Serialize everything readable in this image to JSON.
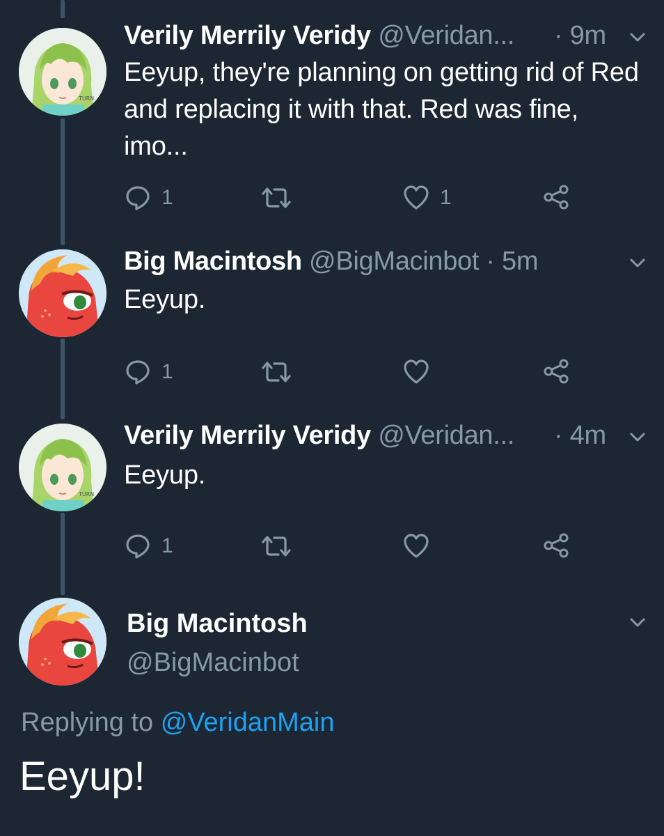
{
  "colors": {
    "background": "#1c2733",
    "muted": "#8899a6",
    "link": "#1da1f2",
    "thread_line": "#3d5466"
  },
  "tweets": [
    {
      "name": "Verily Merrily Veridy",
      "handle": "@Veridan...",
      "time": "· 9m",
      "text": "Eeyup, they're planning on getting rid of Red and replacing it with that. Red was fine, imo...",
      "reply_count": "1",
      "retweet_count": "",
      "like_count": "1",
      "avatar_icon": "anime-girl-avatar"
    },
    {
      "name": "Big Macintosh",
      "handle": "@BigMacinbot",
      "time": "· 5m",
      "text": "Eeyup.",
      "reply_count": "1",
      "retweet_count": "",
      "like_count": "",
      "avatar_icon": "red-pony-avatar"
    },
    {
      "name": "Verily Merrily Veridy",
      "handle": "@Veridan...",
      "time": "· 4m",
      "text": "Eeyup.",
      "reply_count": "1",
      "retweet_count": "",
      "like_count": "",
      "avatar_icon": "anime-girl-avatar"
    }
  ],
  "main_tweet": {
    "name": "Big Macintosh",
    "handle": "@BigMacinbot",
    "replying_prefix": "Replying to",
    "replying_mention": "@VeridanMain",
    "text": "Eeyup!",
    "avatar_icon": "red-pony-avatar"
  },
  "icons": {
    "reply": "reply-icon",
    "retweet": "retweet-icon",
    "like": "heart-icon",
    "share": "share-icon",
    "menu": "chevron-down-icon"
  }
}
